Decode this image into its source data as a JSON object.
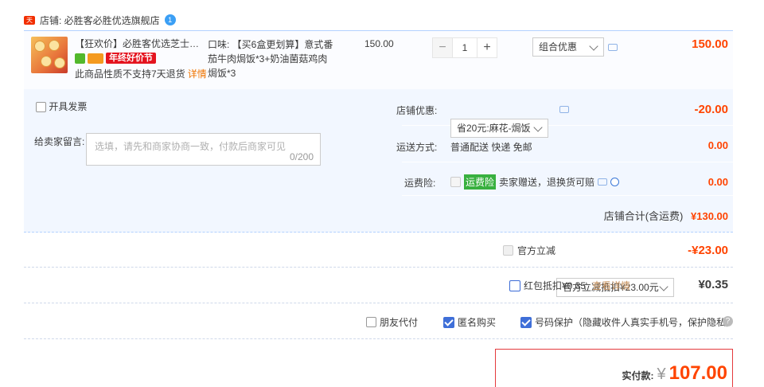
{
  "shop": {
    "tag": "天猫",
    "label": "店铺: 必胜客必胜优选旗舰店",
    "ww": "1"
  },
  "item": {
    "title": "【狂欢价】必胜客优选芝士焗饭...",
    "badge": "年终好价节",
    "no_return": "此商品性质不支持7天退货",
    "detail_link": "详情",
    "sku": "口味: 【买6盒更划算】意式番茄牛肉焗饭*3+奶油菌菇鸡肉焗饭*3",
    "unit_price": "150.00",
    "qty": "1",
    "minus": "−",
    "plus": "+",
    "promo": "组合优惠",
    "subtotal": "150.00"
  },
  "invoice": "开具发票",
  "message": {
    "label": "给卖家留言:",
    "placeholder": "选填，请先和商家协商一致，付款后商家可见",
    "count": "0/200"
  },
  "shop_coupon": {
    "label": "店铺优惠:",
    "value": "省20元:麻花-焗饭",
    "amount": "-20.00"
  },
  "shipping": {
    "label": "运送方式:",
    "value": "普通配送 快递 免邮",
    "amount": "0.00"
  },
  "insurance": {
    "label": "运费险:",
    "tag": "运费险",
    "value": "卖家赠送，退换货可赔",
    "amount": "0.00"
  },
  "shop_total": {
    "label": "店铺合计(含运费)",
    "amount": "¥130.00"
  },
  "official": {
    "label": "官方立减",
    "value": "官方立减抵扣¥23.00元",
    "amount": "-¥23.00"
  },
  "redpacket": {
    "label": "红包抵扣¥0.35",
    "link": "查看详情",
    "amount": "¥0.35"
  },
  "options": {
    "friend": "朋友代付",
    "anonymous": "匿名购买",
    "privacy": "号码保护（隐藏收件人真实手机号，保护隐私）"
  },
  "pay": {
    "label": "实付款:",
    "currency": "¥",
    "amount": "107.00"
  },
  "colors": {
    "accent": "#ff4400",
    "border": "#b2d1ff",
    "bg": "#f2f7ff"
  }
}
